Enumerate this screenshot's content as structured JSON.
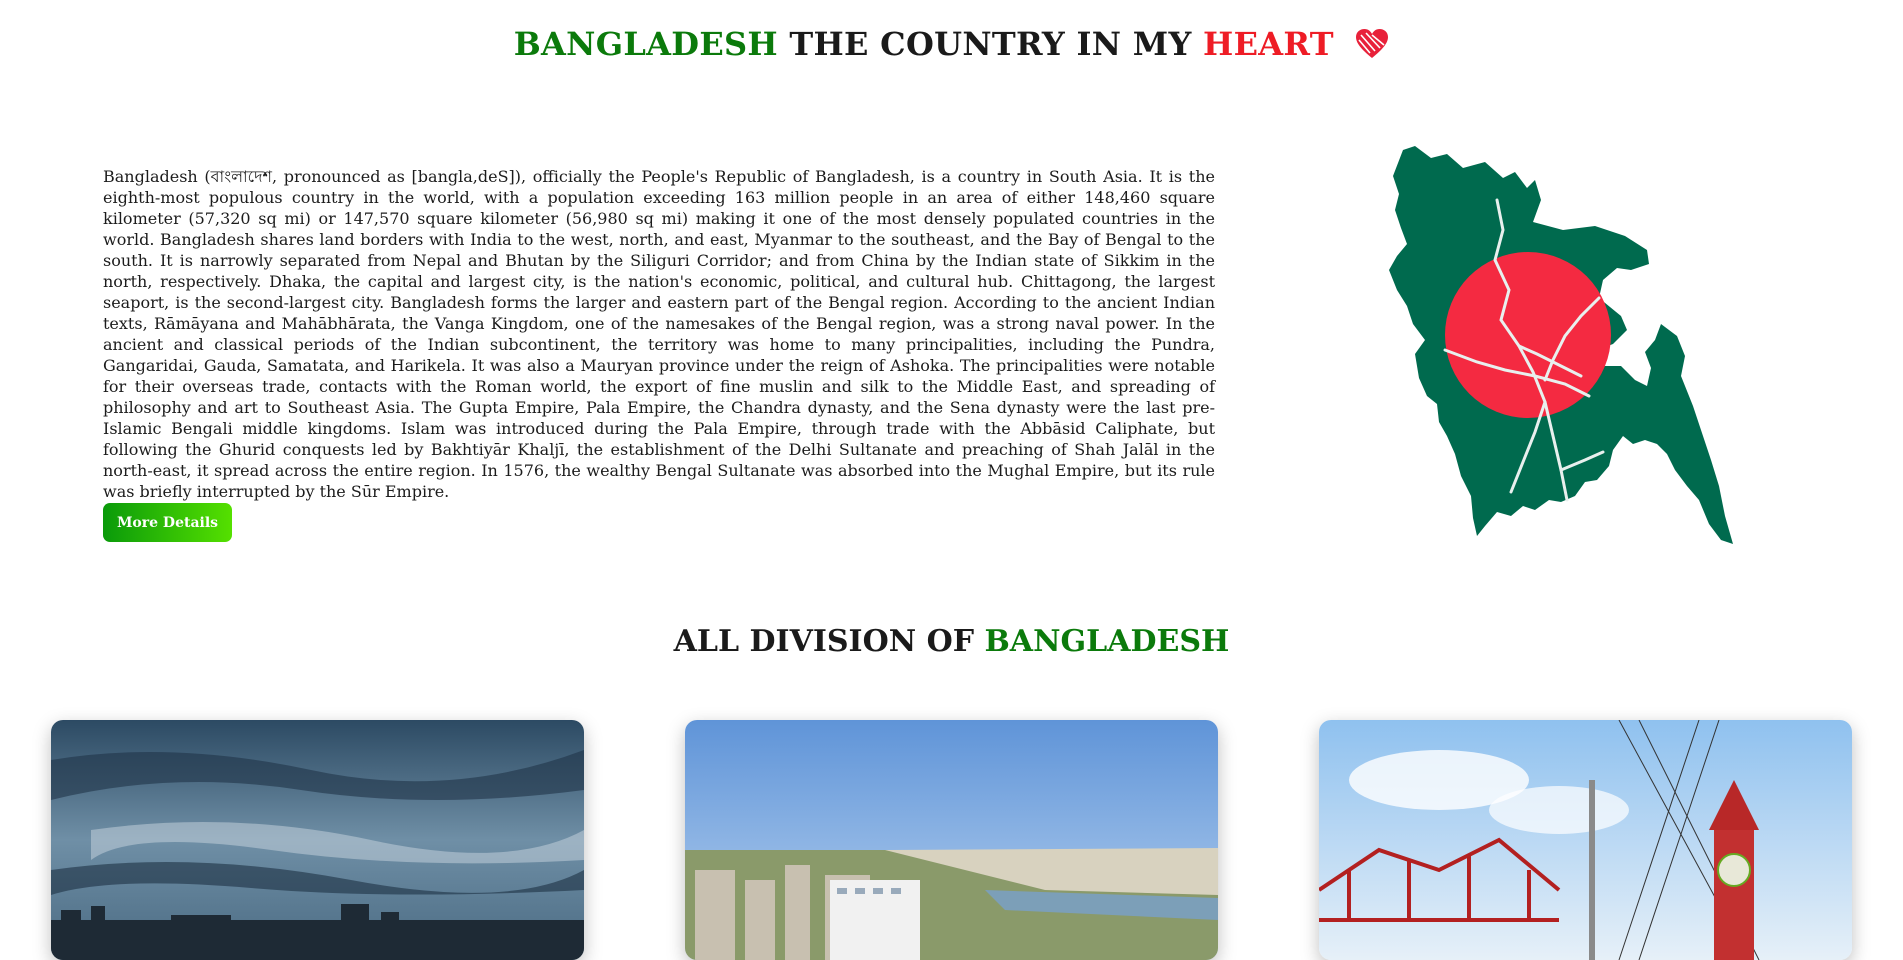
{
  "header": {
    "title_part1": "BANGLADESH",
    "title_part2": " THE COUNTRY IN MY ",
    "title_part3": "HEART"
  },
  "intro": {
    "text": "Bangladesh (বাংলাদেশ, pronounced as [bangla,deS]), officially the People's Republic of Bangladesh, is a country in South Asia. It is the eighth-most populous country in the world, with a population exceeding 163 million people in an area of either 148,460 square kilometer (57,320 sq mi) or 147,570 square kilometer (56,980 sq mi) making it one of the most densely populated countries in the world. Bangladesh shares land borders with India to the west, north, and east, Myanmar to the southeast, and the Bay of Bengal to the south. It is narrowly separated from Nepal and Bhutan by the Siliguri Corridor; and from China by the Indian state of Sikkim in the north, respectively. Dhaka, the capital and largest city, is the nation's economic, political, and cultural hub. Chittagong, the largest seaport, is the second-largest city. Bangladesh forms the larger and eastern part of the Bengal region. According to the ancient Indian texts, Rāmāyana and Mahābhārata, the Vanga Kingdom, one of the namesakes of the Bengal region, was a strong naval power. In the ancient and classical periods of the Indian subcontinent, the territory was home to many principalities, including the Pundra, Gangaridai, Gauda, Samatata, and Harikela. It was also a Mauryan province under the reign of Ashoka. The principalities were notable for their overseas trade, contacts with the Roman world, the export of fine muslin and silk to the Middle East, and spreading of philosophy and art to Southeast Asia. The Gupta Empire, Pala Empire, the Chandra dynasty, and the Sena dynasty were the last pre-Islamic Bengali middle kingdoms. Islam was introduced during the Pala Empire, through trade with the Abbāsid Caliphate, but following the Ghurid conquests led by Bakhtiyār Khaljī, the establishment of the Delhi Sultanate and preaching of Shah Jalāl in the north-east, it spread across the entire region. In 1576, the wealthy Bengal Sultanate was absorbed into the Mughal Empire, but its rule was briefly interrupted by the Sūr Empire.",
    "button_label": "More Details"
  },
  "divisions": {
    "title_part1": "ALL DIVISION OF ",
    "title_part2": "BANGLADESH"
  },
  "colors": {
    "flag_green": "#006a4e",
    "flag_red": "#f42a41",
    "accent_green": "#0b7a0b",
    "accent_red": "#ee1c25"
  },
  "icons": [
    "heart-icon"
  ]
}
